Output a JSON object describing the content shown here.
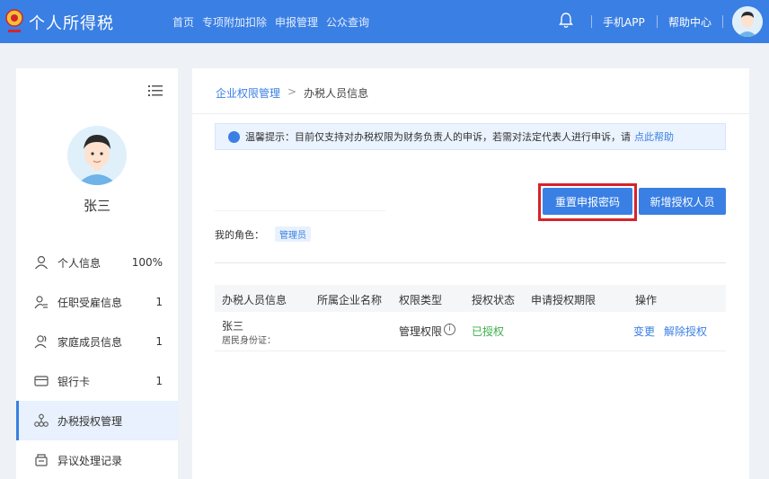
{
  "header": {
    "app_title": "个人所得税",
    "nav": [
      "首页",
      "专项附加扣除",
      "申报管理",
      "公众查询"
    ],
    "mobile_app": "手机APP",
    "help_center": "帮助中心",
    "accent_color": "#3a7fe3"
  },
  "sidebar": {
    "user_name": "张三",
    "items": [
      {
        "label": "个人信息",
        "count": "100%",
        "icon": "person-icon"
      },
      {
        "label": "任职受雇信息",
        "count": "1",
        "icon": "person-list-icon"
      },
      {
        "label": "家庭成员信息",
        "count": "1",
        "icon": "family-icon"
      },
      {
        "label": "银行卡",
        "count": "1",
        "icon": "bank-card-icon"
      },
      {
        "label": "办税授权管理",
        "count": "",
        "icon": "org-chart-icon",
        "active": true
      },
      {
        "label": "异议处理记录",
        "count": "",
        "icon": "record-icon"
      }
    ]
  },
  "breadcrumb": {
    "parent": "企业权限管理",
    "separator": ">",
    "current": "办税人员信息"
  },
  "notice": {
    "text": "温馨提示：目前仅支持对办税权限为财务负责人的申诉，若需对法定代表人进行申诉，请",
    "link": "点此帮助"
  },
  "buttons": {
    "reset_password": "重置申报密码",
    "add_person": "新增授权人员"
  },
  "role": {
    "label": "我的角色：",
    "value": "管理员"
  },
  "table": {
    "headers": [
      "办税人员信息",
      "所属企业名称",
      "权限类型",
      "授权状态",
      "申请授权期限",
      "操作"
    ],
    "rows": [
      {
        "name": "张三",
        "id_label": "居民身份证：",
        "company": "",
        "type": "管理权限",
        "status": "已授权",
        "period": "",
        "actions": [
          "变更",
          "解除授权"
        ]
      }
    ]
  },
  "colors": {
    "status_ok": "#3cae49",
    "highlight_border": "#d6232b"
  }
}
